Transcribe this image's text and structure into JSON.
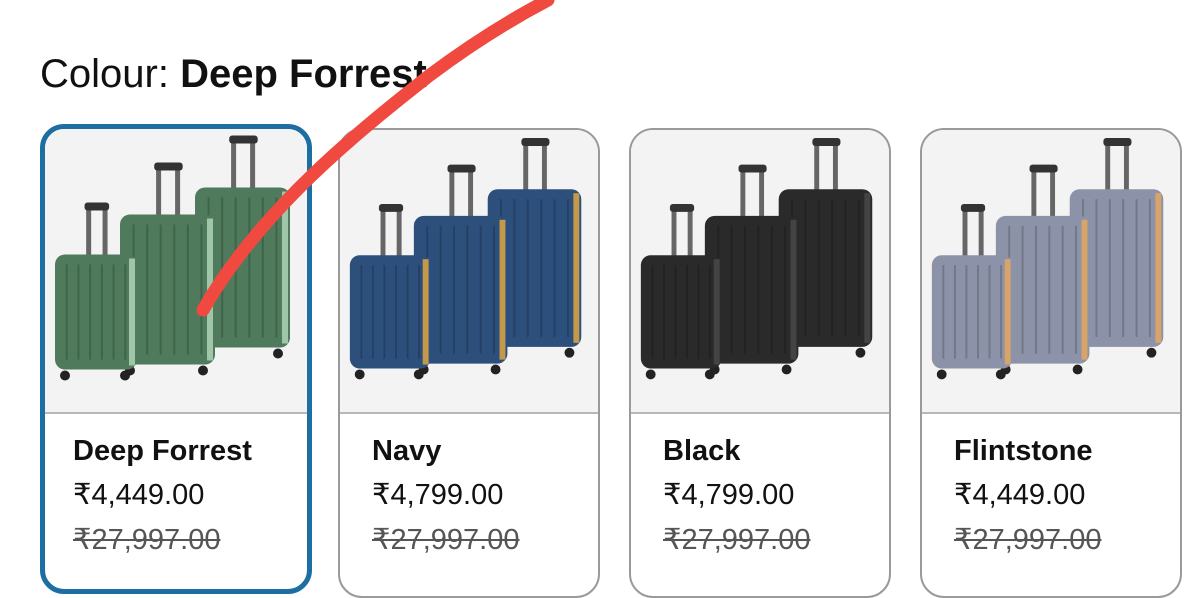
{
  "colour": {
    "label": "Colour:",
    "selected": "Deep Forrest"
  },
  "swatches": [
    {
      "name": "Deep Forrest",
      "price": "₹4,449.00",
      "mrp": "₹27,997.00",
      "color": "#4f7a5c",
      "edge": "#9fc6a8",
      "selected": true
    },
    {
      "name": "Navy",
      "price": "₹4,799.00",
      "mrp": "₹27,997.00",
      "color": "#2d4f7c",
      "edge": "#c49a4a",
      "selected": false
    },
    {
      "name": "Black",
      "price": "₹4,799.00",
      "mrp": "₹27,997.00",
      "color": "#2a2a2a",
      "edge": "#444444",
      "selected": false
    },
    {
      "name": "Flintstone",
      "price": "₹4,449.00",
      "mrp": "₹27,997.00",
      "color": "#8c93a8",
      "edge": "#d9a46a",
      "selected": false
    }
  ],
  "annotation_color": "#f04a40"
}
